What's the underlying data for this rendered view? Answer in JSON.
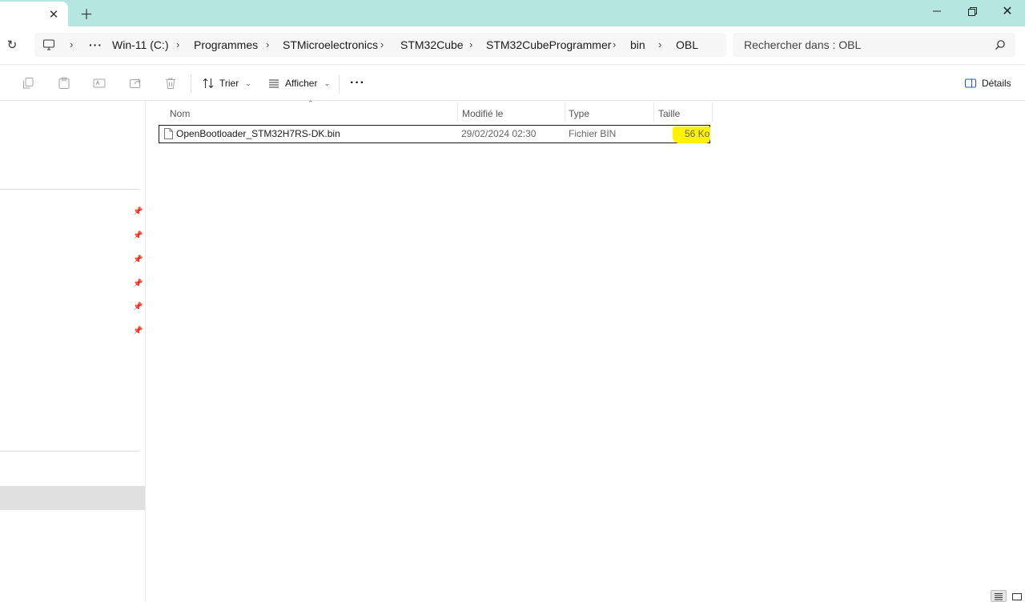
{
  "window": {
    "tab_close_icon": "close-icon",
    "new_tab_icon": "plus-icon",
    "minimize_icon": "minimize-icon",
    "maximize_icon": "restore-icon",
    "close_icon": "close-icon"
  },
  "address": {
    "refresh_icon": "refresh-icon",
    "computer_icon": "computer-icon",
    "overflow": "···",
    "crumbs": [
      "Win-11 (C:)",
      "Programmes",
      "STMicroelectronics",
      "STM32Cube",
      "STM32CubeProgrammer",
      "bin",
      "OBL"
    ]
  },
  "search": {
    "placeholder": "Rechercher dans : OBL",
    "icon": "search-icon"
  },
  "toolbar": {
    "copy_icon": "copy-icon",
    "paste_icon": "paste-icon",
    "rename_icon": "rename-icon",
    "share_icon": "share-icon",
    "delete_icon": "delete-icon",
    "sort_label": "Trier",
    "view_label": "Afficher",
    "more_label": "···",
    "details_label": "Détails"
  },
  "columns": {
    "name": "Nom",
    "modified": "Modifié le",
    "type": "Type",
    "size": "Taille"
  },
  "files": [
    {
      "name": "OpenBootloader_STM32H7RS-DK.bin",
      "modified": "29/02/2024 02:30",
      "type": "Fichier BIN",
      "size": "56 Ko",
      "icon": "file-icon"
    }
  ],
  "colors": {
    "titlebar": "#b5e6e0",
    "highlight": "#fff200",
    "nav_selected": "#e0e0e0"
  }
}
